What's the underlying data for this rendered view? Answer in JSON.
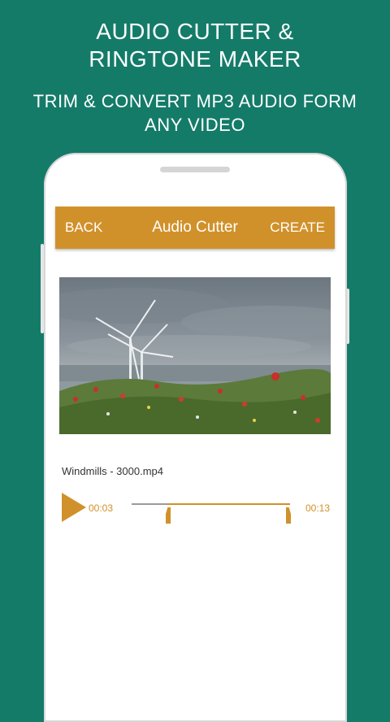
{
  "promo": {
    "title_line1": "AUDIO CUTTER &",
    "title_line2": "RINGTONE MAKER",
    "subtitle_line1": "TRIM & CONVERT MP3 AUDIO FORM",
    "subtitle_line2": "ANY  VIDEO"
  },
  "toolbar": {
    "back_label": "BACK",
    "title": "Audio Cutter",
    "create_label": "CREATE"
  },
  "media": {
    "filename": "Windmills - 3000.mp4",
    "start_time": "00:03",
    "end_time": "00:13"
  },
  "colors": {
    "background": "#147b69",
    "accent": "#d1912a"
  },
  "icons": {
    "play": "play-icon"
  }
}
